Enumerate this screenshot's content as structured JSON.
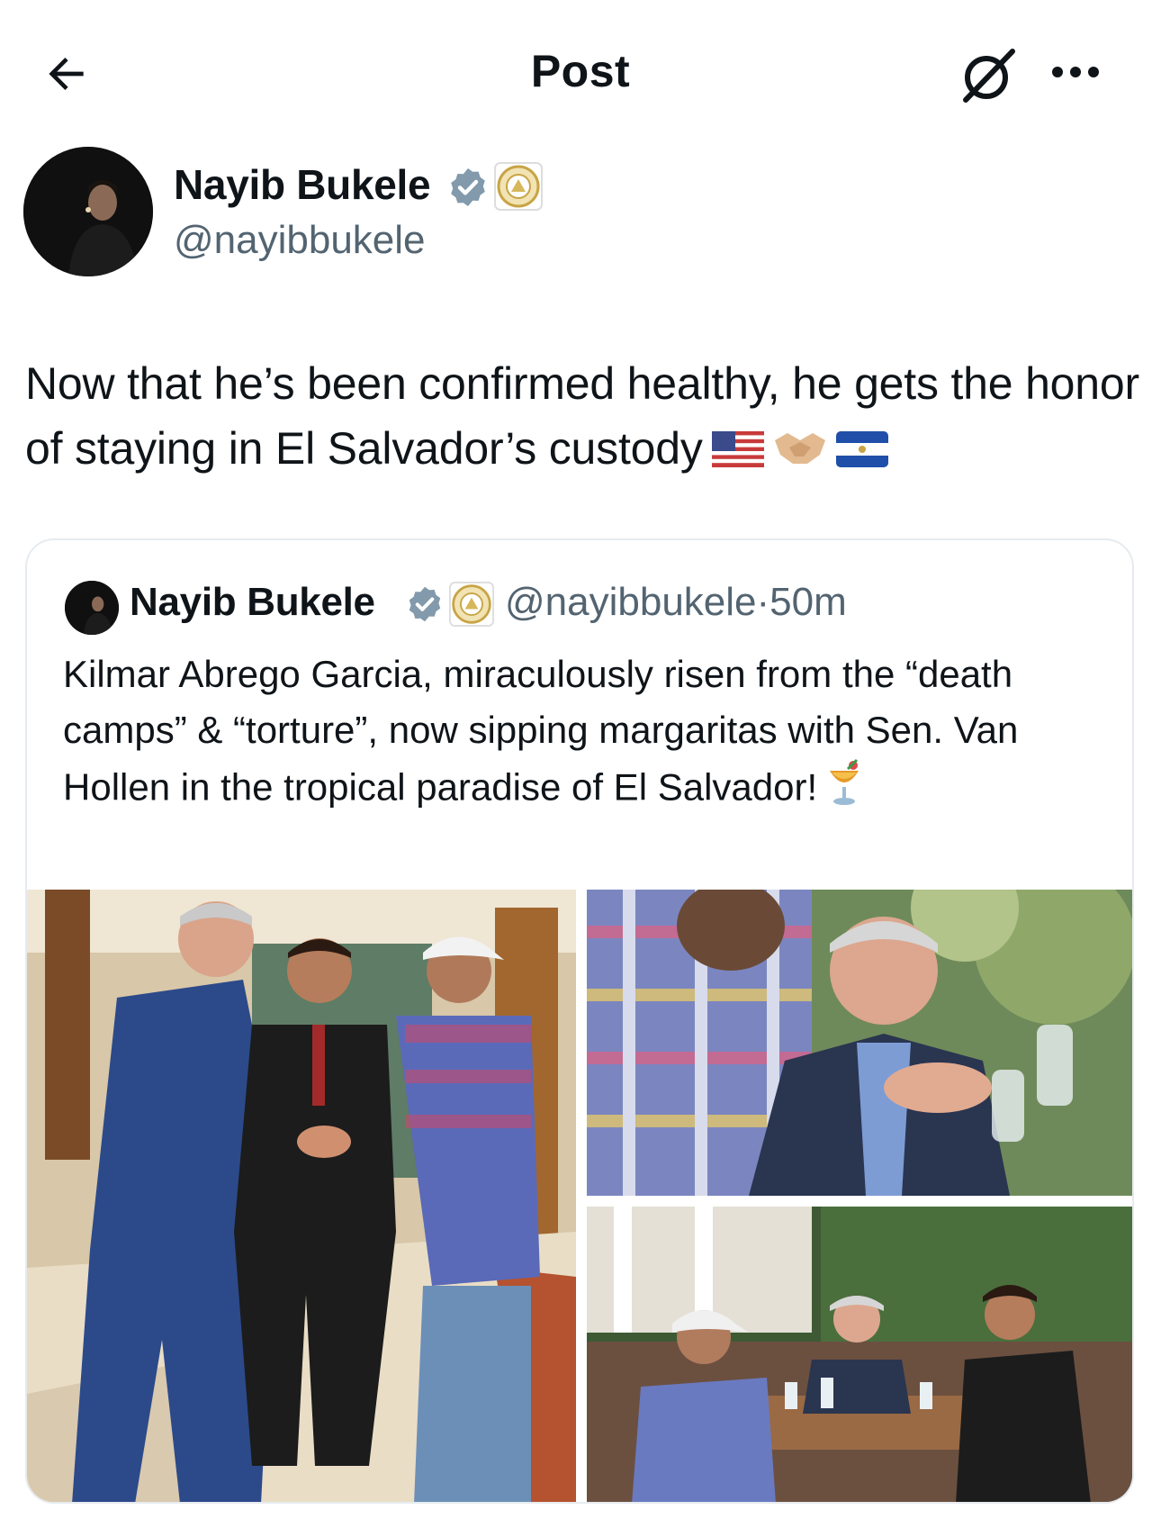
{
  "header": {
    "title": "Post",
    "back_icon": "arrow-left-icon",
    "grok_icon": "grok-icon",
    "more_icon": "more-horizontal-icon"
  },
  "post": {
    "author": {
      "name": "Nayib Bukele",
      "handle": "@nayibbukele",
      "verified": true
    },
    "text": "Now that he’s been confirmed healthy, he gets the honor of staying in El Salvador’s custody",
    "emojis": [
      "us-flag-emoji",
      "handshake-emoji",
      "el-salvador-flag-emoji"
    ]
  },
  "quote": {
    "author": {
      "name": "Nayib Bukele",
      "handle": "@nayibbukele",
      "time": "50m",
      "separator": "·"
    },
    "text": "Kilmar Abrego Garcia, miraculously risen from the “death camps” & “torture”, now sipping margaritas with Sen. Van Hollen in the tropical paradise of El Salvador!",
    "emoji": "tropical-drink-emoji",
    "photos": [
      {
        "name": "handshake-lobby-photo"
      },
      {
        "name": "senator-closeup-photo"
      },
      {
        "name": "restaurant-table-photo"
      }
    ]
  },
  "colors": {
    "text": "#0f1419",
    "secondary": "#536471",
    "verified": "#829aab",
    "border": "#e6ebef"
  }
}
